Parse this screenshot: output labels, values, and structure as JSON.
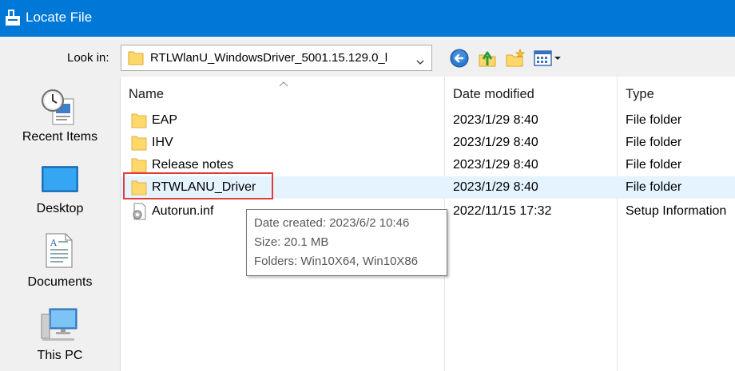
{
  "window": {
    "title": "Locate File"
  },
  "toolbar": {
    "lookin_label": "Look in:",
    "lookin_value": "RTLWlanU_WindowsDriver_5001.15.129.0_l",
    "buttons": [
      "back-icon",
      "up-folder-icon",
      "new-folder-icon",
      "view-menu-icon"
    ]
  },
  "places": [
    {
      "label": "Recent Items",
      "icon": "recent-items-icon"
    },
    {
      "label": "Desktop",
      "icon": "desktop-icon"
    },
    {
      "label": "Documents",
      "icon": "documents-icon"
    },
    {
      "label": "This PC",
      "icon": "this-pc-icon"
    }
  ],
  "columns": {
    "name": "Name",
    "date": "Date modified",
    "type": "Type"
  },
  "files": [
    {
      "name": "EAP",
      "date": "2023/1/29 8:40",
      "type": "File folder",
      "icon": "folder-icon"
    },
    {
      "name": "IHV",
      "date": "2023/1/29 8:40",
      "type": "File folder",
      "icon": "folder-icon"
    },
    {
      "name": "Release notes",
      "date": "2023/1/29 8:40",
      "type": "File folder",
      "icon": "folder-icon"
    },
    {
      "name": "RTWLANU_Driver",
      "date": "2023/1/29 8:40",
      "type": "File folder",
      "icon": "folder-icon"
    },
    {
      "name": "Autorun.inf",
      "date": "2022/11/15 17:32",
      "type": "Setup Information",
      "icon": "setup-file-icon"
    }
  ],
  "tooltip": {
    "created": "Date created: 2023/6/2 10:46",
    "size": "Size: 20.1 MB",
    "folders": "Folders: Win10X64, Win10X86"
  },
  "colors": {
    "titlebar": "#0078d7",
    "hover_row": "#e5f3ff",
    "highlight_box": "#e03c3c",
    "folder": "#ffd86b"
  }
}
